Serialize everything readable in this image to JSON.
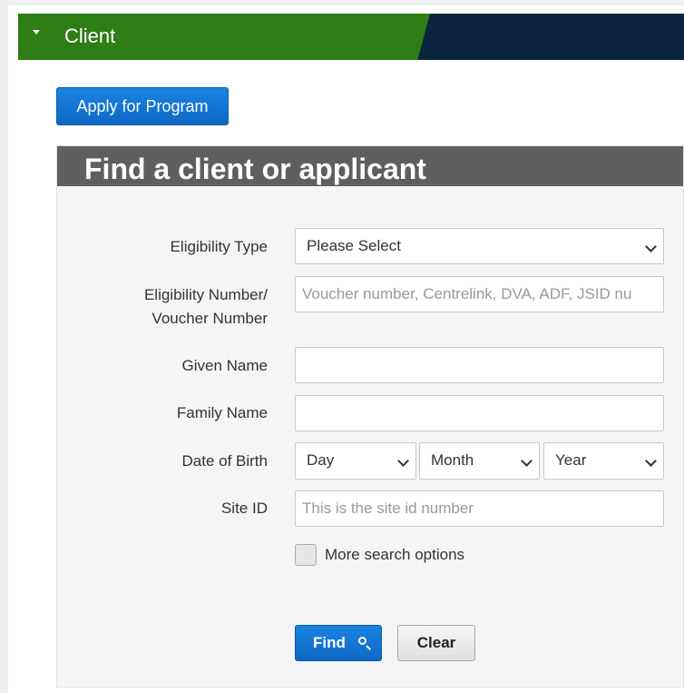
{
  "panel": {
    "title": "Client"
  },
  "actions": {
    "apply_label": "Apply for Program"
  },
  "find": {
    "title": "Find a client or applicant",
    "eligibility_type": {
      "label": "Eligibility Type",
      "selected": "Please Select"
    },
    "eligibility_number": {
      "label_line1": "Eligibility Number/",
      "label_line2": "Voucher Number",
      "placeholder": "Voucher number, Centrelink, DVA, ADF, JSID nu"
    },
    "given_name": {
      "label": "Given Name",
      "value": ""
    },
    "family_name": {
      "label": "Family Name",
      "value": ""
    },
    "dob": {
      "label": "Date of Birth",
      "day": "Day",
      "month": "Month",
      "year": "Year"
    },
    "site_id": {
      "label": "Site ID",
      "placeholder": "This is the site id number"
    },
    "more_options_label": "More search options",
    "find_label": "Find",
    "clear_label": "Clear"
  },
  "colors": {
    "header_green": "#2e7d15",
    "header_navy": "#0b2540",
    "primary_blue": "#0f67c6",
    "find_header_gray": "#5f5f5f"
  },
  "icons": [
    "chevron-down-icon",
    "search-icon"
  ]
}
